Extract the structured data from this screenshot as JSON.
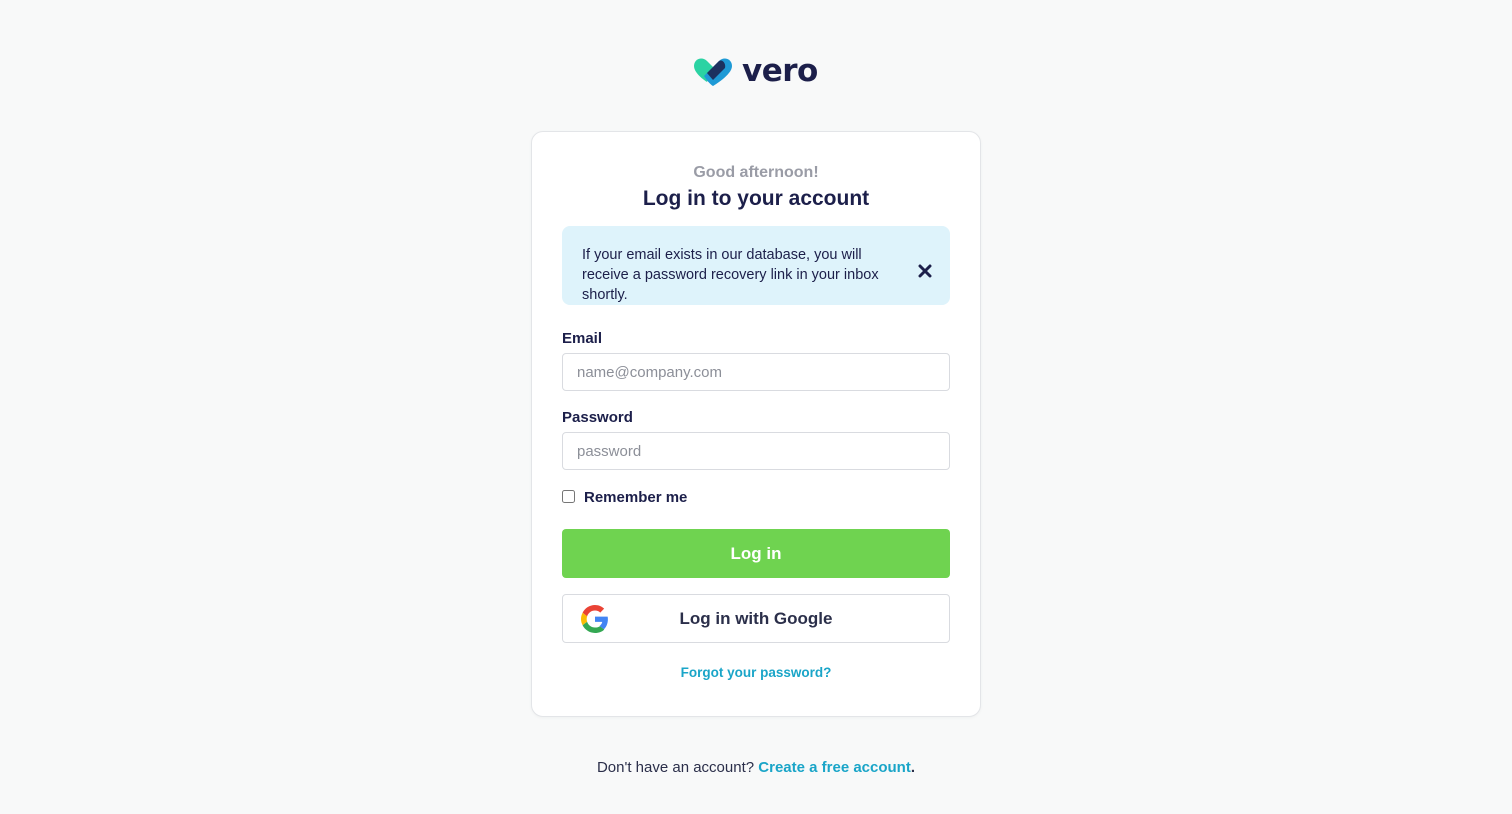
{
  "brand": {
    "name": "vero",
    "logo_icon": "vero-heart-logo",
    "colors": {
      "navy": "#1c1f4a",
      "teal": "#2bd3a3",
      "blue": "#1e9ad6"
    }
  },
  "login": {
    "greeting": "Good afternoon!",
    "title": "Log in to your account",
    "alert": {
      "message": "If your email exists in our database, you will receive a password recovery link in your inbox shortly.",
      "close_icon": "close-icon",
      "background": "#def3fb"
    },
    "email": {
      "label": "Email",
      "placeholder": "name@company.com",
      "value": ""
    },
    "password": {
      "label": "Password",
      "placeholder": "password",
      "value": ""
    },
    "remember": {
      "label": "Remember me",
      "checked": false
    },
    "login_button": {
      "label": "Log in",
      "color": "#6fd350"
    },
    "google_button": {
      "label": "Log in with Google",
      "icon": "google-icon"
    },
    "forgot_link": "Forgot your password?"
  },
  "footer": {
    "prompt": "Don't have an account?",
    "signup_link": "Create a free account",
    "suffix": ".",
    "link_color": "#1aa5c8"
  }
}
